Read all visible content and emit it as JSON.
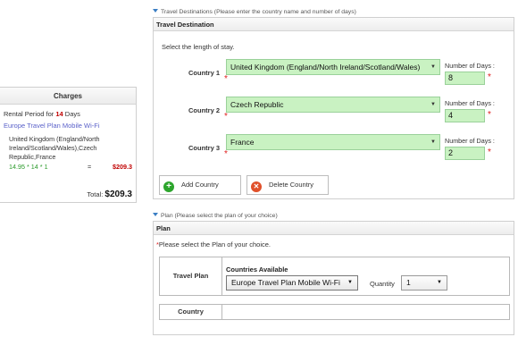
{
  "charges": {
    "title": "Charges",
    "rental_prefix": "Rental Period for ",
    "rental_days": "14",
    "rental_suffix": " Days",
    "plan_name": "Europe Travel Plan Mobile Wi-Fi",
    "countries": "United Kingdom (England/North Ireland/Scotland/Wales),Czech Republic,France",
    "calc": "14.95 * 14 * 1",
    "equals": "=",
    "subtotal": "$209.3",
    "total_label": "Total: ",
    "total_value": "$209.3"
  },
  "travel_section": {
    "label": "Travel Destinations (Please enter the country name and number of days)",
    "heading": "Travel Destination",
    "instruction": "Select the length of stay.",
    "days_label": "Number of Days :",
    "required_mark": "*",
    "rows": [
      {
        "label": "Country 1",
        "country": "United Kingdom (England/North Ireland/Scotland/Wales)",
        "days": "8"
      },
      {
        "label": "Country 2",
        "country": "Czech Republic",
        "days": "4"
      },
      {
        "label": "Country 3",
        "country": "France",
        "days": "2"
      }
    ],
    "add_button": "Add Country",
    "delete_button": "Delete Country"
  },
  "plan_section": {
    "label": "Plan (Please select the plan of your choice)",
    "heading": "Plan",
    "prompt_star": "*",
    "prompt": "Please select the Plan of your choice.",
    "travel_plan_label": "Travel Plan",
    "countries_available_label": "Countries Available",
    "selected_plan": "Europe Travel Plan Mobile Wi-Fi",
    "quantity_label": "Quantity",
    "quantity": "1",
    "country_label": "Country"
  },
  "colors": {
    "accent": "#3a7ec4",
    "field_green": "#c9f2c2",
    "required_red": "#e02020",
    "price_red": "#c00000",
    "calc_green": "#2a9a2a",
    "plan_link": "#5a61c9"
  },
  "icons": {
    "dropdown": "triangle-down",
    "add": "plus-circle",
    "delete": "x-circle",
    "section": "triangle-down"
  }
}
